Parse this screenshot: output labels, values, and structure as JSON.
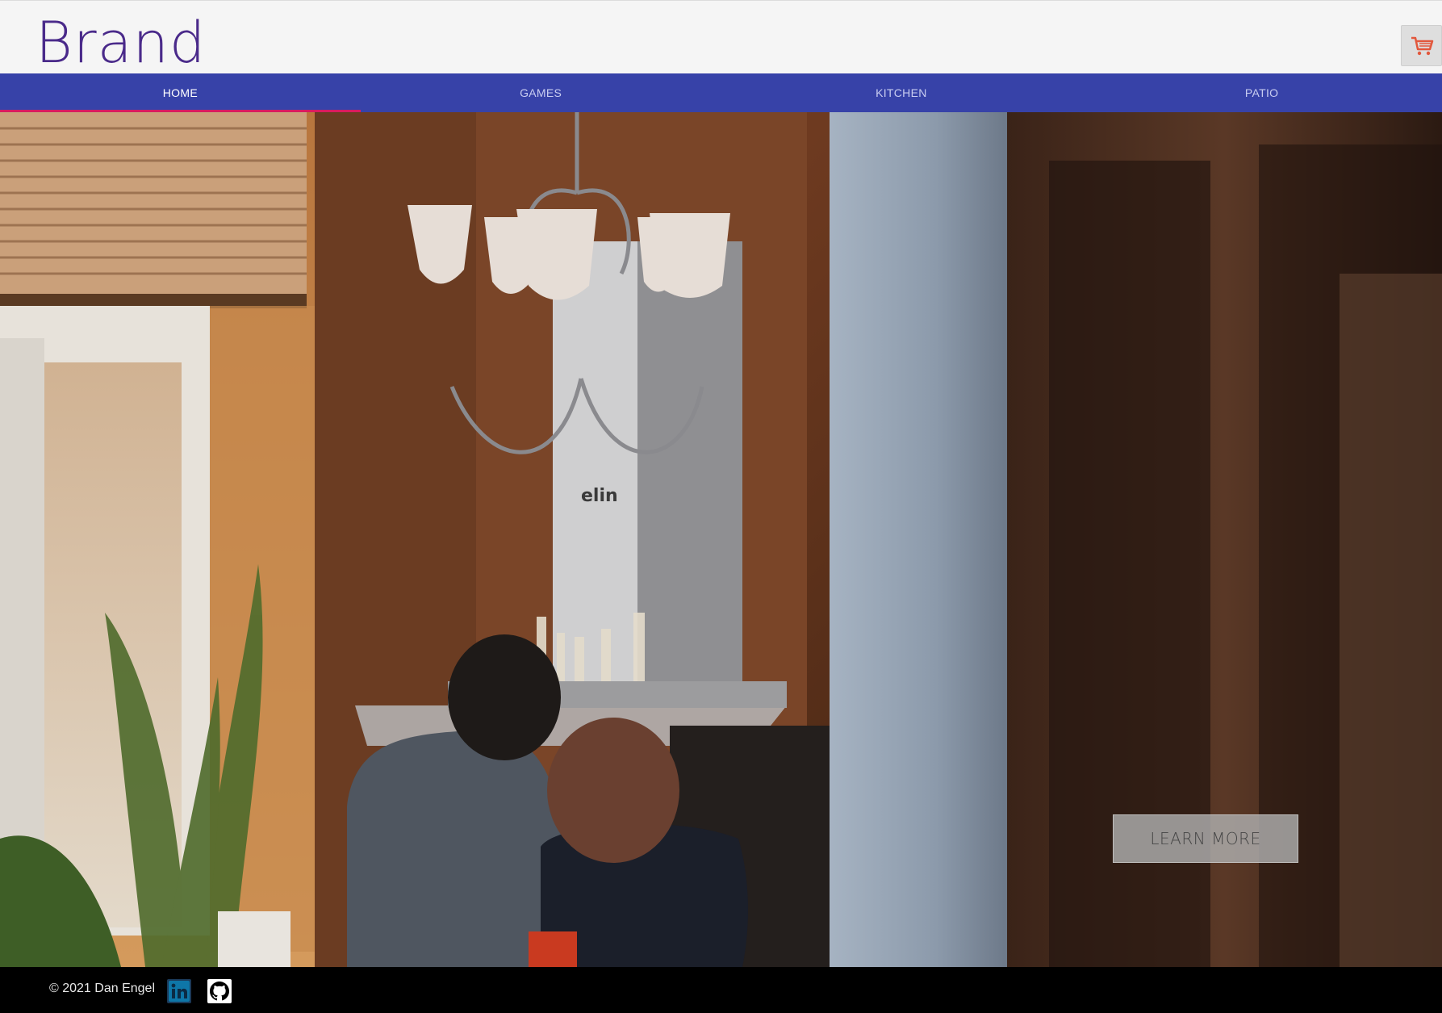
{
  "header": {
    "brand": "Brand",
    "cart_icon": "shopping-cart-icon",
    "cart_icon_color": "#e2573c"
  },
  "nav": {
    "items": [
      {
        "label": "HOME",
        "active": true
      },
      {
        "label": "GAMES",
        "active": false
      },
      {
        "label": "KITCHEN",
        "active": false
      },
      {
        "label": "PATIO",
        "active": false
      }
    ],
    "background_color": "#3742a8",
    "active_indicator_color": "#d81b60"
  },
  "hero": {
    "image": "couple-cooking-in-kitchen-photo",
    "hood_brand_text": "elin",
    "cta_label": "LEARN MORE"
  },
  "footer": {
    "copyright": "© 2021 Dan Engel",
    "links": [
      {
        "icon": "linkedin-icon"
      },
      {
        "icon": "github-icon"
      }
    ]
  }
}
